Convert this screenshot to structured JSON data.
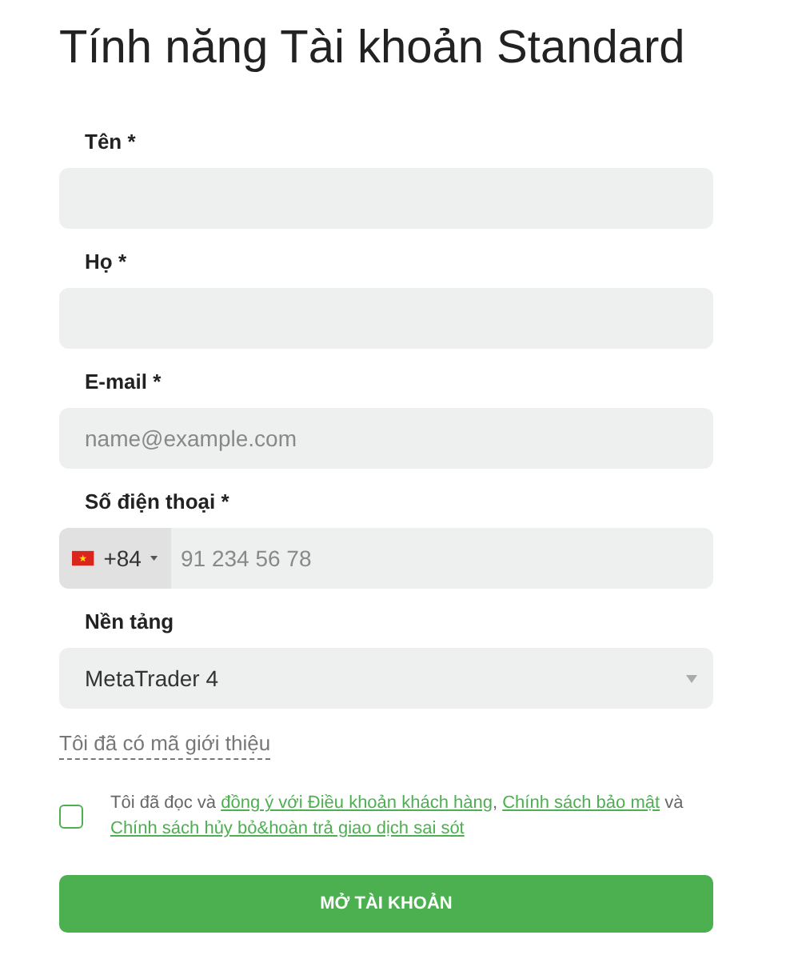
{
  "title": "Tính năng Tài khoản Standard",
  "fields": [
    {
      "kind": "text",
      "label": "Tên *"
    },
    {
      "kind": "text",
      "label": "Họ *"
    },
    {
      "kind": "text",
      "label": "E-mail *",
      "placeholder": "name@example.com"
    },
    {
      "kind": "phone",
      "label": "Số điện thoại *",
      "code": "+84",
      "placeholder": "91 234 56 78"
    },
    {
      "kind": "select",
      "label": "Nền tảng",
      "value": "MetaTrader 4"
    }
  ],
  "referral_link": "Tôi đã có mã giới thiệu",
  "consent": {
    "checked": false,
    "parts": [
      {
        "kind": "text",
        "text": "Tôi đã đọc và "
      },
      {
        "kind": "link",
        "text": "đồng ý với Điều khoản khách hàng"
      },
      {
        "kind": "text",
        "text": ", "
      },
      {
        "kind": "link",
        "text": "Chính sách bảo mật"
      },
      {
        "kind": "text",
        "text": " và "
      },
      {
        "kind": "link",
        "text": "Chính sách hủy bỏ&hoàn trả giao dịch sai sót"
      }
    ]
  },
  "submit": "MỞ TÀI KHOẢN"
}
